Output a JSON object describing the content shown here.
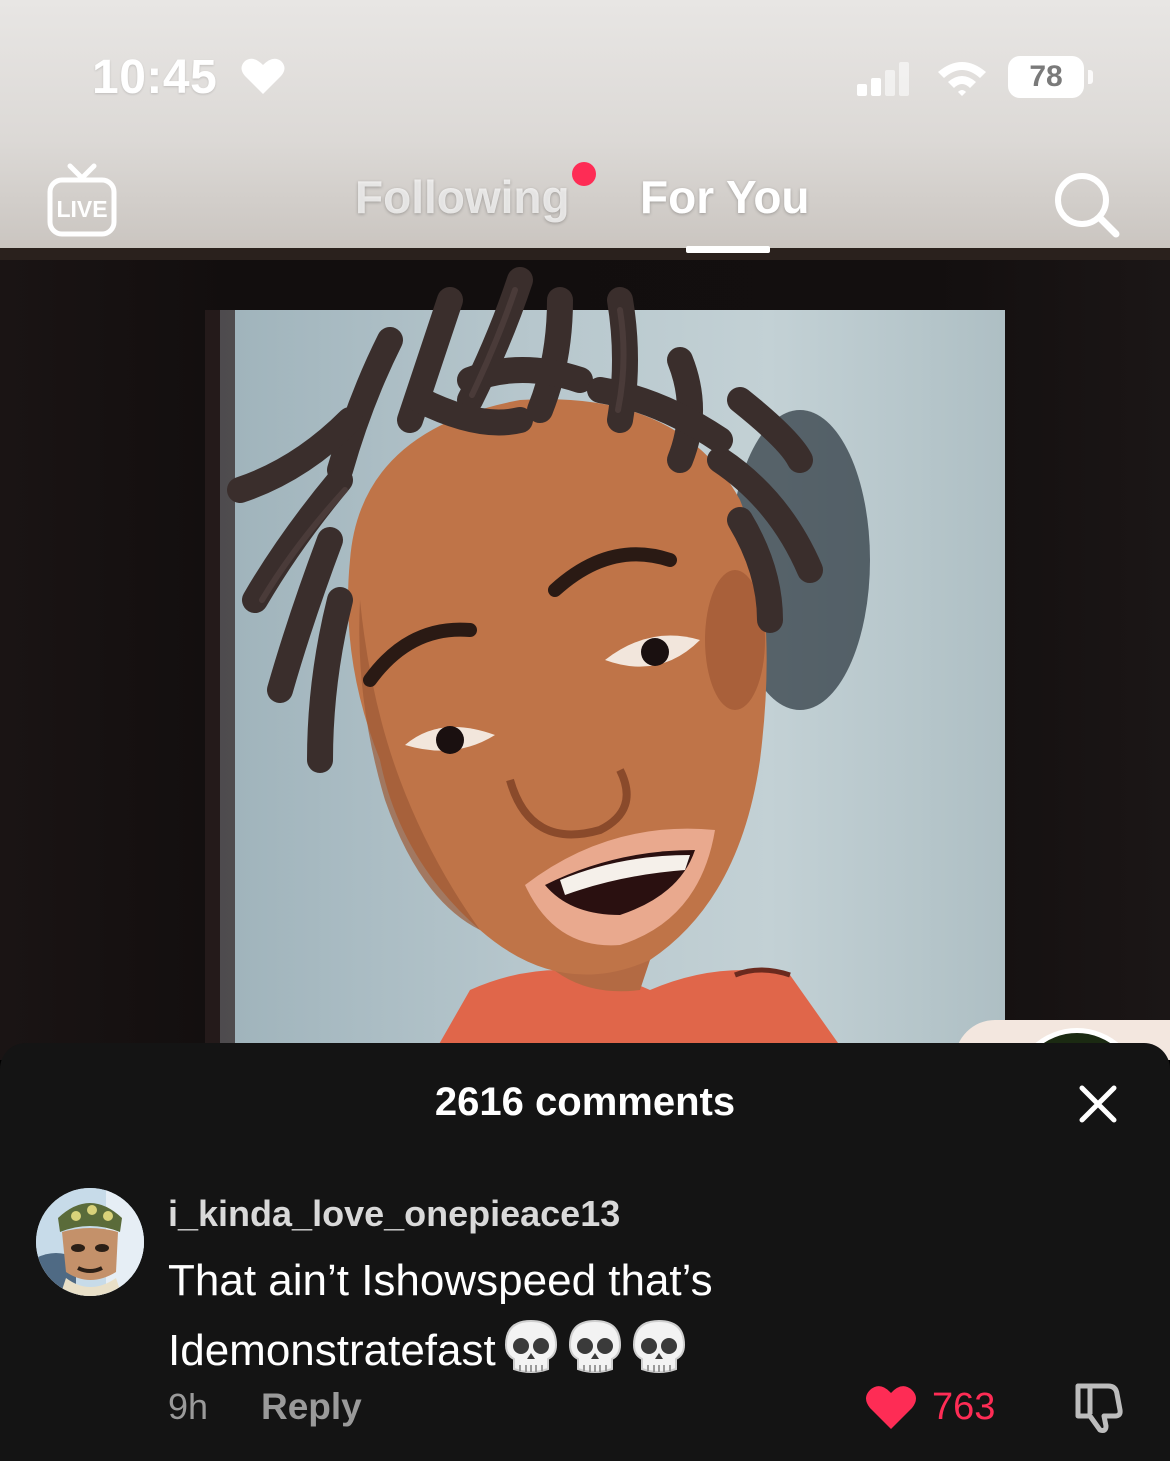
{
  "status_bar": {
    "time": "10:45",
    "battery": "78"
  },
  "top_nav": {
    "live_label": "LIVE",
    "tabs": [
      {
        "label": "Following"
      },
      {
        "label": "For You"
      }
    ],
    "active_tab": "For You"
  },
  "comments": {
    "title": "2616 comments",
    "items": [
      {
        "username": "i_kinda_love_onepieace13",
        "text": "That ain’t Ishowspeed that’s Idemonstratefast",
        "time": "9h",
        "reply_label": "Reply",
        "likes": "763"
      }
    ]
  },
  "colors": {
    "accent": "#fe2c55",
    "sheet_bg": "#141414"
  },
  "icons": [
    "heart-icon",
    "signal-icon",
    "wifi-icon",
    "battery-icon",
    "live-tv-icon",
    "search-icon",
    "close-icon",
    "skull-emoji",
    "like-heart-icon",
    "dislike-icon"
  ]
}
